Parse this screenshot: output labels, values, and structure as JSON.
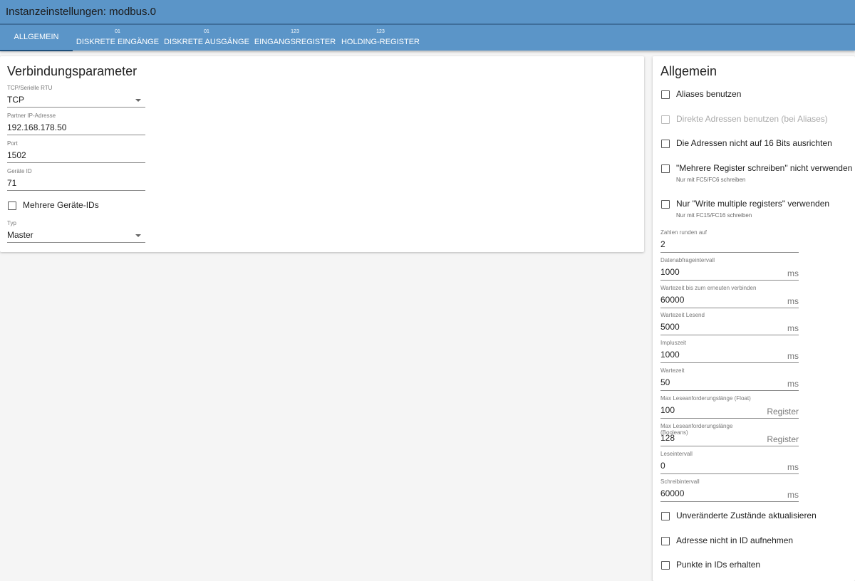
{
  "window": {
    "title": "Instanzeinstellungen: modbus.0"
  },
  "tabs": [
    {
      "label": "Allgemein",
      "icon": ""
    },
    {
      "label": "Diskrete Eingänge",
      "icon": "01"
    },
    {
      "label": "Diskrete Ausgänge",
      "icon": "01"
    },
    {
      "label": "Eingangsregister",
      "icon": "123"
    },
    {
      "label": "Holding-Register",
      "icon": "123"
    }
  ],
  "left": {
    "title": "Verbindungsparameter",
    "connection": {
      "label": "TCP/Serielle RTU",
      "value": "TCP"
    },
    "ip": {
      "label": "Partner IP-Adresse",
      "value": "192.168.178.50"
    },
    "port": {
      "label": "Port",
      "value": "1502"
    },
    "device_id": {
      "label": "Geräte ID",
      "value": "71"
    },
    "multi_ids": {
      "label": "Mehrere Geräte-IDs",
      "checked": false
    },
    "type": {
      "label": "Typ",
      "value": "Master"
    }
  },
  "right": {
    "title": "Allgemein",
    "checkboxes": [
      {
        "label": "Aliases benutzen",
        "hint": "",
        "checked": false,
        "disabled": false
      },
      {
        "label": "Direkte Adressen benutzen (bei Aliases)",
        "hint": "",
        "checked": false,
        "disabled": true
      },
      {
        "label": "Die Adressen nicht auf 16 Bits ausrichten",
        "hint": "",
        "checked": false,
        "disabled": false
      },
      {
        "label": "\"Mehrere Register schreiben\" nicht verwenden",
        "hint": "Nur mit FC5/FC6 schreiben",
        "checked": false,
        "disabled": false
      },
      {
        "label": "Nur \"Write multiple registers\" verwenden",
        "hint": "Nur mit FC15/FC16 schreiben",
        "checked": false,
        "disabled": false
      }
    ],
    "fields": [
      {
        "label": "Zahlen runden auf",
        "value": "2",
        "unit": ""
      },
      {
        "label": "Datenabfrageintervall",
        "value": "1000",
        "unit": "ms"
      },
      {
        "label": "Wartezeit bis zum erneuten verbinden",
        "value": "60000",
        "unit": "ms"
      },
      {
        "label": "Wartezeit Lesend",
        "value": "5000",
        "unit": "ms"
      },
      {
        "label": "Impluszeit",
        "value": "1000",
        "unit": "ms"
      },
      {
        "label": "Wartezeit",
        "value": "50",
        "unit": "ms"
      },
      {
        "label": "Max Leseanforderungslänge (Float)",
        "value": "100",
        "unit": "Register"
      },
      {
        "label": "Max Leseanforderungslänge (Booleans)",
        "value": "128",
        "unit": "Register"
      },
      {
        "label": "Leseintervall",
        "value": "0",
        "unit": "ms"
      },
      {
        "label": "Schreibintervall",
        "value": "60000",
        "unit": "ms"
      }
    ],
    "bottom_checkboxes": [
      {
        "label": "Unveränderte Zustände aktualisieren",
        "checked": false
      },
      {
        "label": "Adresse nicht in ID aufnehmen",
        "checked": false
      },
      {
        "label": "Punkte in IDs erhalten",
        "checked": false
      }
    ]
  }
}
